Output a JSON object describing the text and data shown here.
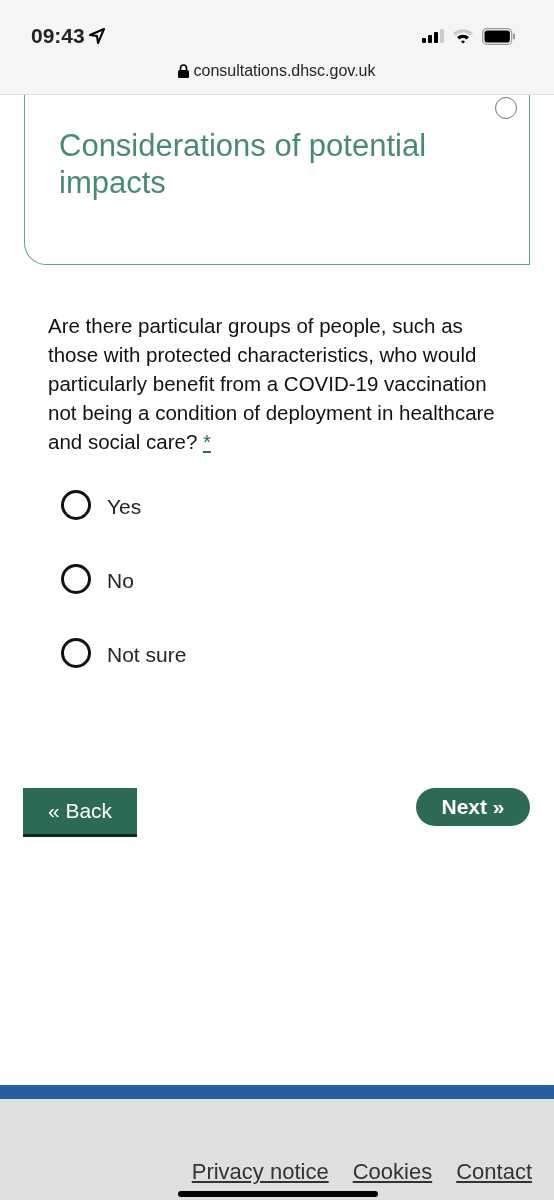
{
  "status_bar": {
    "time": "09:43"
  },
  "browser": {
    "address": "consultations.dhsc.gov.uk"
  },
  "section": {
    "title": "Considerations of potential impacts"
  },
  "question": {
    "text": "Are there particular groups of people, such as those with protected characteristics, who would particularly benefit from a COVID-19 vaccination not being a condition of deployment in healthcare and social care?",
    "required_mark": "*"
  },
  "options": [
    {
      "label": "Yes",
      "selected": false
    },
    {
      "label": "No",
      "selected": false
    },
    {
      "label": "Not sure",
      "selected": false
    }
  ],
  "buttons": {
    "back": "« Back",
    "next": "Next »"
  },
  "footer": {
    "links": [
      "Privacy notice",
      "Cookies",
      "Contact"
    ]
  }
}
